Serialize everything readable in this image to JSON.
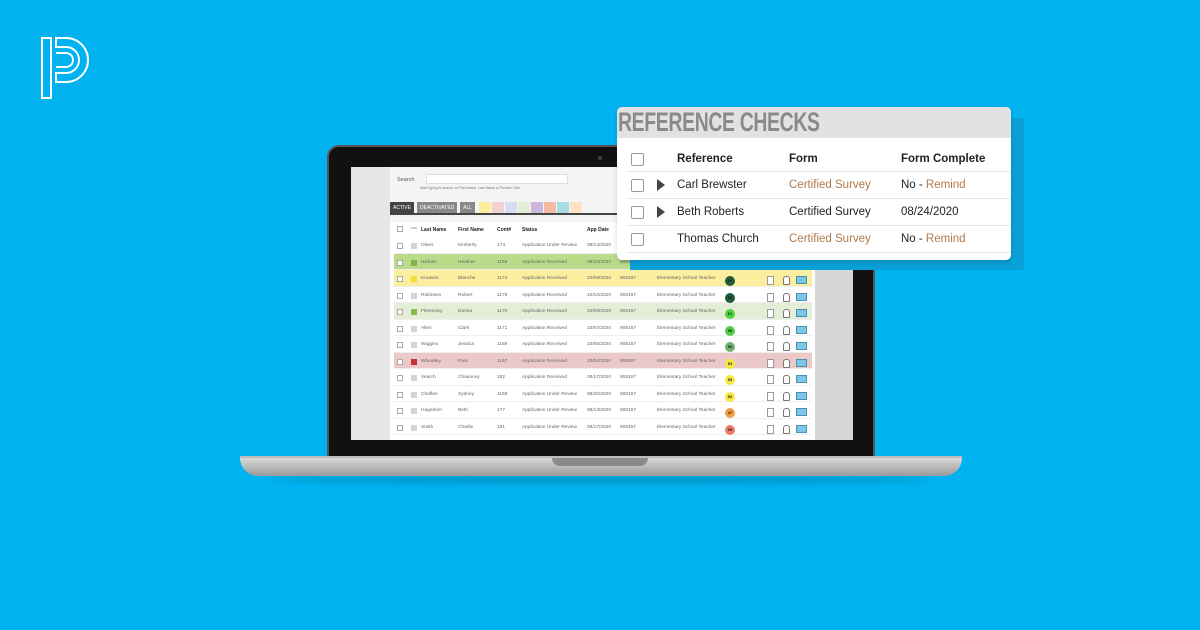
{
  "brand": {
    "logo": "powerschool-p-logo"
  },
  "app": {
    "search_label": "Search",
    "search_value": "",
    "search_hint": "Start typing to search on First Name, Last Name or Position Title.",
    "tabs": [
      "ACTIVE",
      "DEACTIVATED",
      "ALL"
    ],
    "swatches": [
      "#fbef9f",
      "#f2d0d0",
      "#d6dcf2",
      "#e4eed4",
      "#cdb6dc",
      "#f6b9a3",
      "#a6dde2",
      "#fde2c3"
    ],
    "columns": [
      "Last Name",
      "First Name",
      "Cont#",
      "Status",
      "App Date"
    ],
    "rows": [
      {
        "last": "Oliver",
        "first": "Kimberly",
        "cont": "174",
        "status": "Application Under Review",
        "date": "08/14/2020",
        "id": "",
        "position": "",
        "score": "",
        "score_color": "",
        "bg": "#ffffff",
        "tag": "#d4d4d4"
      },
      {
        "last": "Nichols",
        "first": "Heather",
        "cont": "1159",
        "status": "Application Received",
        "date": "08/24/2020",
        "id": "908167",
        "position": "",
        "score": "",
        "score_color": "#1e5e3a",
        "bg": "#b8dc8a",
        "tag": "#8ab04a",
        "editing": true
      },
      {
        "last": "Knutson",
        "first": "Blanche",
        "cont": "1174",
        "status": "Application Received",
        "date": "10/09/2020",
        "id": "908167",
        "position": "Elementary School Teacher",
        "score": "63",
        "score_color": "#1f5d3a",
        "bg": "#fbee9f",
        "tag": "#f5dc3c"
      },
      {
        "last": "Robinson",
        "first": "Robert",
        "cont": "1176",
        "status": "Application Received",
        "date": "10/12/2020",
        "id": "908167",
        "position": "Elementary School Teacher",
        "score": "63",
        "score_color": "#1f5d3a",
        "bg": "#ffffff",
        "tag": "#d4d4d4"
      },
      {
        "last": "Flemming",
        "first": "Donna",
        "cont": "1170",
        "status": "Application Received",
        "date": "10/09/2020",
        "id": "908167",
        "position": "Elementary School Teacher",
        "score": "61",
        "score_color": "#4fd43c",
        "bg": "#e4edd5",
        "tag": "#8ab84a"
      },
      {
        "last": "Allen",
        "first": "Clark",
        "cont": "1171",
        "status": "Application Received",
        "date": "10/07/2020",
        "id": "908167",
        "position": "Elementary School Teacher",
        "score": "58",
        "score_color": "#52cc48",
        "bg": "#ffffff",
        "tag": "#d4d4d4"
      },
      {
        "last": "Wiggins",
        "first": "Jessica",
        "cont": "1169",
        "status": "Application Received",
        "date": "10/05/2020",
        "id": "908167",
        "position": "Elementary School Teacher",
        "score": "56",
        "score_color": "#6db46e",
        "bg": "#ffffff",
        "tag": "#d4d4d4"
      },
      {
        "last": "Wheatley",
        "first": "Paul",
        "cont": "1167",
        "status": "Application Received",
        "date": "10/02/2020",
        "id": "908167",
        "position": "Elementary School Teacher",
        "score": "54",
        "score_color": "#f6e640",
        "bg": "#ecc9c9",
        "tag": "#c83232"
      },
      {
        "last": "Veatch",
        "first": "Chauncey",
        "cont": "182",
        "status": "Application Received",
        "date": "08/17/2020",
        "id": "908167",
        "position": "Elementary School Teacher",
        "score": "53",
        "score_color": "#f6e640",
        "bg": "#ffffff",
        "tag": "#d4d4d4"
      },
      {
        "last": "Chaffee",
        "first": "Sydney",
        "cont": "1158",
        "status": "Application Under Review",
        "date": "08/20/2020",
        "id": "908167",
        "position": "Elementary School Teacher",
        "score": "52",
        "score_color": "#f6e640",
        "bg": "#ffffff",
        "tag": "#d4d4d4"
      },
      {
        "last": "Hagedorn",
        "first": "Beth",
        "cont": "177",
        "status": "Application Under Review",
        "date": "08/14/2020",
        "id": "908167",
        "position": "Elementary School Teacher",
        "score": "47",
        "score_color": "#f0a040",
        "bg": "#ffffff",
        "tag": "#d4d4d4"
      },
      {
        "last": "Smith",
        "first": "Charlie",
        "cont": "181",
        "status": "Application Under Review",
        "date": "08/17/2020",
        "id": "908167",
        "position": "Elementary School Teacher",
        "score": "39",
        "score_color": "#ee7a6a",
        "bg": "#ffffff",
        "tag": "#d4d4d4"
      }
    ]
  },
  "reference_checks": {
    "title": "REFERENCE CHECKS",
    "columns": [
      "Reference",
      "Form",
      "Form Complete"
    ],
    "rows": [
      {
        "name": "Carl Brewster",
        "form": "Certified Survey",
        "form_link": true,
        "complete": "No - ",
        "remind": "Remind",
        "expandable": true
      },
      {
        "name": "Beth Roberts",
        "form": "Certified Survey",
        "form_link": false,
        "complete": "08/24/2020",
        "remind": "",
        "expandable": true
      },
      {
        "name": "Thomas Church",
        "form": "Certified Survey",
        "form_link": true,
        "complete": "No - ",
        "remind": "Remind",
        "expandable": false
      }
    ]
  },
  "colors": {
    "background": "#00b3f0",
    "link": "#b07a4a"
  }
}
